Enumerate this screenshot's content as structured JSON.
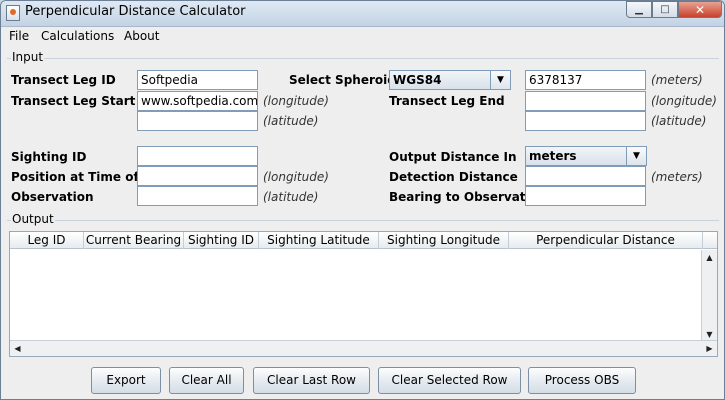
{
  "window": {
    "title": "Perpendicular Distance Calculator"
  },
  "menu": {
    "file": "File",
    "calculations": "Calculations",
    "about": "About"
  },
  "input": {
    "title": "Input",
    "transect_leg_id": {
      "label": "Transect Leg ID",
      "value": "Softpedia"
    },
    "select_spheroid": {
      "label": "Select Spheroid",
      "value": "WGS84",
      "radius": "6378137",
      "radius_unit": "(meters)"
    },
    "transect_leg_start": {
      "label": "Transect Leg Start",
      "lon": "www.softpedia.com",
      "lat": "",
      "lon_unit": "(longitude)",
      "lat_unit": "(latitude)"
    },
    "transect_leg_end": {
      "label": "Transect Leg End",
      "lon": "",
      "lat": "",
      "lon_unit": "(longitude)",
      "lat_unit": "(latitude)"
    },
    "sighting_id": {
      "label": "Sighting ID",
      "value": ""
    },
    "output_distance_in": {
      "label": "Output Distance In",
      "value": "meters"
    },
    "position_label_1": "Position at Time of",
    "position_label_2": "Observation",
    "position": {
      "lon": "",
      "lat": "",
      "lon_unit": "(longitude)",
      "lat_unit": "(latitude)"
    },
    "detection_distance": {
      "label": "Detection Distance",
      "value": "",
      "unit": "(meters)"
    },
    "bearing": {
      "label": "Bearing to Observation",
      "value": ""
    }
  },
  "output": {
    "title": "Output",
    "columns": [
      "Leg ID",
      "Current Bearing",
      "Sighting ID",
      "Sighting Latitude",
      "Sighting Longitude",
      "Perpendicular Distance"
    ],
    "rows": []
  },
  "buttons": {
    "export": "Export",
    "clear_all": "Clear All",
    "clear_last_row": "Clear Last Row",
    "clear_selected_row": "Clear Selected Row",
    "process_obs": "Process OBS"
  }
}
